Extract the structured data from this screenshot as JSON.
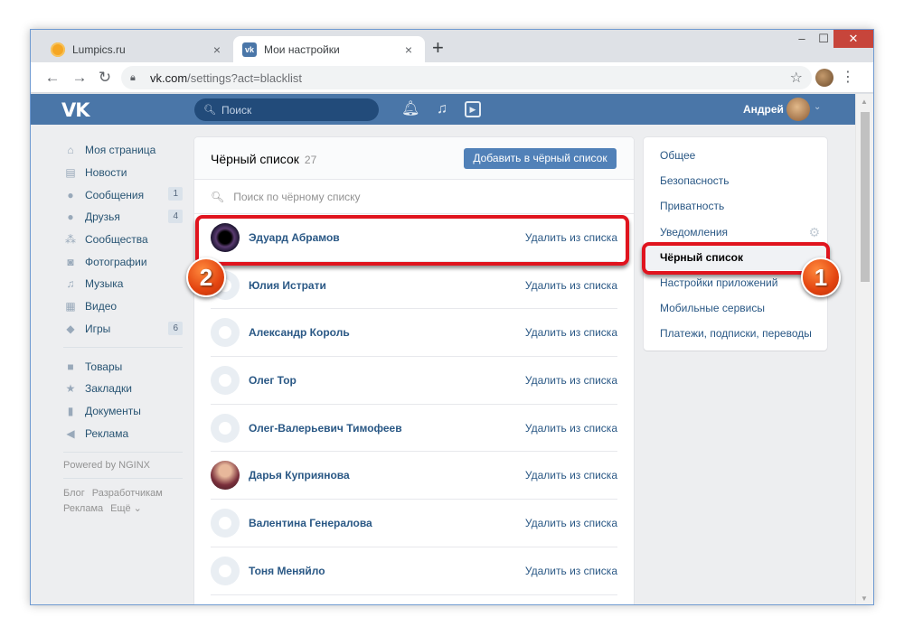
{
  "browser": {
    "tabs": [
      {
        "title": "Lumpics.ru",
        "close": "×"
      },
      {
        "title": "Мои настройки",
        "close": "×"
      }
    ],
    "new_tab": "+",
    "url_host": "vk.com",
    "url_path": "/settings?act=blacklist"
  },
  "vk_header": {
    "logo": "VK",
    "search_placeholder": "Поиск",
    "user_name": "Андрей"
  },
  "left_menu": {
    "items": [
      {
        "label": "Моя страница",
        "icon": "home-icon"
      },
      {
        "label": "Новости",
        "icon": "news-icon"
      },
      {
        "label": "Сообщения",
        "icon": "messages-icon",
        "count": "1"
      },
      {
        "label": "Друзья",
        "icon": "friends-icon",
        "count": "4"
      },
      {
        "label": "Сообщества",
        "icon": "groups-icon"
      },
      {
        "label": "Фотографии",
        "icon": "camera-icon"
      },
      {
        "label": "Музыка",
        "icon": "music-icon"
      },
      {
        "label": "Видео",
        "icon": "video-icon"
      },
      {
        "label": "Игры",
        "icon": "games-icon",
        "count": "6"
      }
    ],
    "items2": [
      {
        "label": "Товары",
        "icon": "shop-icon"
      },
      {
        "label": "Закладки",
        "icon": "star-icon"
      },
      {
        "label": "Документы",
        "icon": "document-icon"
      },
      {
        "label": "Реклама",
        "icon": "ads-icon"
      }
    ],
    "powered": "Powered by NGINX",
    "footer": [
      "Блог",
      "Разработчикам",
      "Реклама",
      "Ещё ⌄"
    ]
  },
  "blacklist": {
    "title": "Чёрный список",
    "count": "27",
    "add_button": "Добавить в чёрный список",
    "search_placeholder": "Поиск по чёрному списку",
    "remove_label": "Удалить из списка",
    "rows": [
      {
        "name": "Эдуард Абрамов",
        "avatar": "dark"
      },
      {
        "name": "Юлия Истрати",
        "avatar": "default"
      },
      {
        "name": "Александр Король",
        "avatar": "default"
      },
      {
        "name": "Олег Тор",
        "avatar": "default"
      },
      {
        "name": "Олег-Валерьевич Тимофеев",
        "avatar": "default"
      },
      {
        "name": "Дарья Куприянова",
        "avatar": "photo"
      },
      {
        "name": "Валентина Генералова",
        "avatar": "default"
      },
      {
        "name": "Тоня Меняйло",
        "avatar": "default"
      }
    ]
  },
  "settings_menu": {
    "items": [
      {
        "label": "Общее"
      },
      {
        "label": "Безопасность"
      },
      {
        "label": "Приватность"
      },
      {
        "label": "Уведомления"
      },
      {
        "label": "Чёрный список",
        "active": true
      },
      {
        "label": "Настройки приложений"
      },
      {
        "label": "Мобильные сервисы"
      },
      {
        "label": "Платежи, подписки, переводы"
      }
    ]
  },
  "annotations": {
    "badge1": "1",
    "badge2": "2",
    "highlight_color": "#e0141e"
  }
}
